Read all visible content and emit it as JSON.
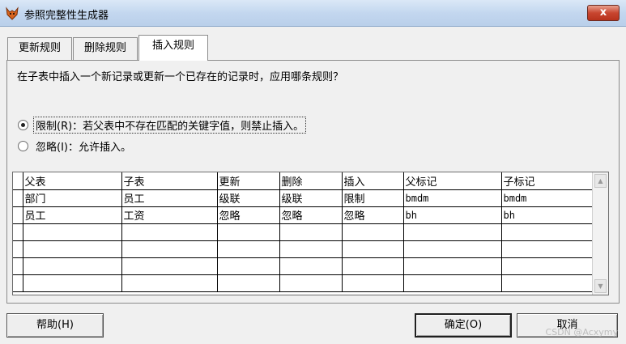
{
  "window": {
    "title": "参照完整性生成器",
    "close_label": "x"
  },
  "tabs": [
    {
      "label": "更新规则",
      "active": false
    },
    {
      "label": "删除规则",
      "active": false
    },
    {
      "label": "插入规则",
      "active": true
    }
  ],
  "panel": {
    "question": "在子表中插入一个新记录或更新一个已存在的记录时，应用哪条规则？",
    "options": [
      {
        "label": "限制(R)：若父表中不存在匹配的关键字值，则禁止插入。",
        "checked": true
      },
      {
        "label": "忽略(I)：允许插入。",
        "checked": false
      }
    ]
  },
  "grid": {
    "columns": [
      "父表",
      "子表",
      "更新",
      "删除",
      "插入",
      "父标记",
      "子标记"
    ],
    "rows": [
      [
        "部门",
        "员工",
        "级联",
        "级联",
        "限制",
        "bmdm",
        "bmdm"
      ],
      [
        "员工",
        "工资",
        "忽略",
        "忽略",
        "忽略",
        "bh",
        "bh"
      ],
      [
        "",
        "",
        "",
        "",
        "",
        "",
        ""
      ],
      [
        "",
        "",
        "",
        "",
        "",
        "",
        ""
      ],
      [
        "",
        "",
        "",
        "",
        "",
        "",
        ""
      ],
      [
        "",
        "",
        "",
        "",
        "",
        "",
        ""
      ]
    ]
  },
  "buttons": {
    "help": "帮助(H)",
    "ok": "确定(O)",
    "cancel": "取消"
  },
  "watermark": "CSDN @Acxymy",
  "colors": {
    "title_bar": "#c3d7ef",
    "close_button": "#c8452f",
    "window_bg": "#f0f0f0"
  }
}
